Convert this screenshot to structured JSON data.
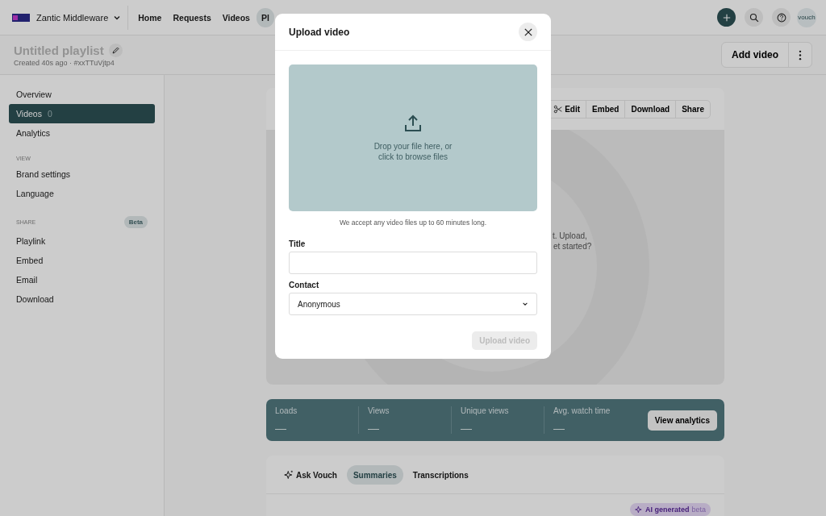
{
  "topbar": {
    "org": "Zantic Middleware",
    "nav": [
      {
        "label": "Home",
        "selected": false
      },
      {
        "label": "Requests",
        "selected": false
      },
      {
        "label": "Videos",
        "selected": false
      },
      {
        "label": "Pl",
        "selected": true
      }
    ],
    "avatar": "vouch"
  },
  "playlist": {
    "title": "Untitled playlist",
    "meta": "Created 40s ago · #xxTTuVjtp4",
    "add_button": "Add video"
  },
  "sidebar": [
    {
      "kind": "item",
      "label": "Overview",
      "selected": false
    },
    {
      "kind": "item",
      "label": "Videos",
      "count": "0",
      "selected": true
    },
    {
      "kind": "item",
      "label": "Analytics",
      "selected": false
    },
    {
      "kind": "heading",
      "label": "VIEW"
    },
    {
      "kind": "item",
      "label": "Brand settings",
      "selected": false
    },
    {
      "kind": "item",
      "label": "Language",
      "selected": false
    },
    {
      "kind": "heading",
      "label": "SHARE",
      "badge": "Beta"
    },
    {
      "kind": "item",
      "label": "Playlink",
      "selected": false
    },
    {
      "kind": "item",
      "label": "Embed",
      "selected": false
    },
    {
      "kind": "item",
      "label": "Email",
      "selected": false
    },
    {
      "kind": "item",
      "label": "Download",
      "selected": false
    }
  ],
  "video_toolbar": [
    "Edit",
    "Embed",
    "Download",
    "Share"
  ],
  "empty_state": [
    "t. Upload,",
    "et started?"
  ],
  "stats": [
    {
      "label": "Loads",
      "value": "—"
    },
    {
      "label": "Views",
      "value": "—"
    },
    {
      "label": "Unique views",
      "value": "—"
    },
    {
      "label": "Avg. watch time",
      "value": "—"
    }
  ],
  "stats_button": "View analytics",
  "insight_tabs": [
    {
      "label": "Ask Vouch",
      "selected": false
    },
    {
      "label": "Summaries",
      "selected": true
    },
    {
      "label": "Transcriptions",
      "selected": false
    }
  ],
  "ai_badge": {
    "label": "AI generated",
    "tag": "beta"
  },
  "modal": {
    "title": "Upload video",
    "dropzone": [
      "Drop your file here, or",
      "click to browse files"
    ],
    "hint": "We accept any video files up to 60 minutes long.",
    "title_field": {
      "label": "Title"
    },
    "contact_field": {
      "label": "Contact",
      "value": "Anonymous"
    },
    "submit": {
      "label": "Upload video",
      "disabled": true
    }
  }
}
